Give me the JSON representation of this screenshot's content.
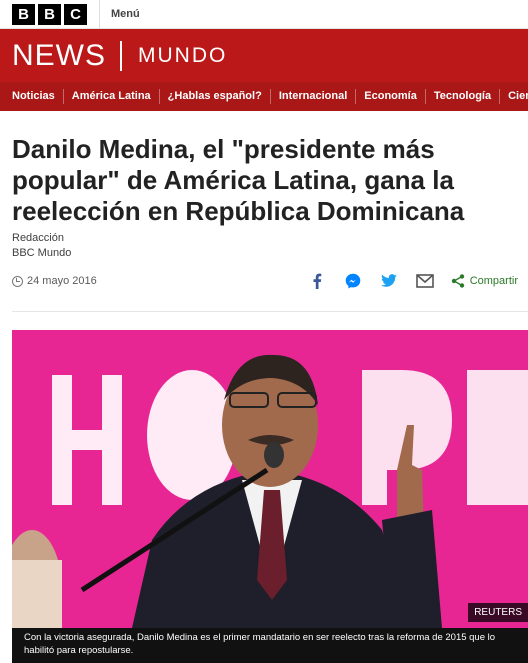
{
  "topbar": {
    "logo_letters": [
      "B",
      "B",
      "C"
    ],
    "menu_label": "Menú"
  },
  "banner": {
    "news": "NEWS",
    "section": "MUNDO"
  },
  "nav": {
    "items": [
      "Noticias",
      "América Latina",
      "¿Hablas español?",
      "Internacional",
      "Economía",
      "Tecnología",
      "Cien"
    ]
  },
  "article": {
    "headline": "Danilo Medina, el \"presidente más popular\" de América Latina, gana la reelección en República Dominicana",
    "author": "Redacción",
    "source": "BBC Mundo",
    "date": "24 mayo 2016",
    "share_label": "Compartir",
    "image_credit": "REUTERS",
    "caption": "Con la victoria asegurada, Danilo Medina es el primer mandatario en ser reelecto tras la reforma de 2015 que lo habilitó para repostularse."
  },
  "colors": {
    "brand_red": "#bb1919",
    "nav_red": "#a91717",
    "photo_pink": "#e41a8a"
  },
  "icons": [
    "clock-icon",
    "facebook-icon",
    "messenger-icon",
    "twitter-icon",
    "email-icon",
    "share-icon"
  ]
}
